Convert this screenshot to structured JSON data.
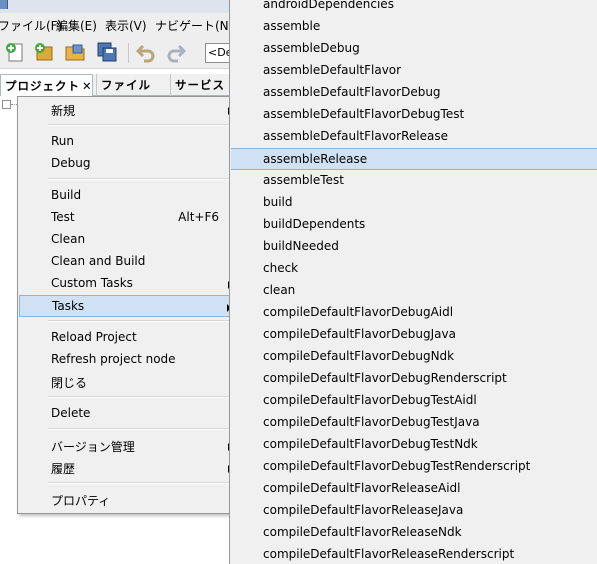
{
  "menubar": {
    "items": [
      "ファイル(F)",
      "編集(E)",
      "表示(V)",
      "ナビゲート(N)"
    ]
  },
  "toolbar": {
    "combo_value": "<De"
  },
  "panel_tabs": [
    {
      "label": "プロジェクト",
      "close": "✕"
    },
    {
      "label": "ファイル"
    },
    {
      "label": "サービス"
    }
  ],
  "tree": {
    "expander": "⊟"
  },
  "context_menu": {
    "new": "新規",
    "run": "Run",
    "debug": "Debug",
    "build": "Build",
    "test": "Test",
    "test_shortcut": "Alt+F6",
    "clean": "Clean",
    "clean_and_build": "Clean and Build",
    "custom_tasks": "Custom Tasks",
    "tasks": "Tasks",
    "reload_project": "Reload Project",
    "refresh_project_node": "Refresh project node",
    "close": "閉じる",
    "delete": "Delete",
    "version_control": "バージョン管理",
    "history": "履歴",
    "properties": "プロパティ"
  },
  "tasks_submenu": {
    "highlighted": "assembleRelease",
    "items": [
      "androidDependencies",
      "assemble",
      "assembleDebug",
      "assembleDefaultFlavor",
      "assembleDefaultFlavorDebug",
      "assembleDefaultFlavorDebugTest",
      "assembleDefaultFlavorRelease",
      "assembleRelease",
      "assembleTest",
      "build",
      "buildDependents",
      "buildNeeded",
      "check",
      "clean",
      "compileDefaultFlavorDebugAidl",
      "compileDefaultFlavorDebugJava",
      "compileDefaultFlavorDebugNdk",
      "compileDefaultFlavorDebugRenderscript",
      "compileDefaultFlavorDebugTestAidl",
      "compileDefaultFlavorDebugTestJava",
      "compileDefaultFlavorDebugTestNdk",
      "compileDefaultFlavorDebugTestRenderscript",
      "compileDefaultFlavorReleaseAidl",
      "compileDefaultFlavorReleaseJava",
      "compileDefaultFlavorReleaseNdk",
      "compileDefaultFlavorReleaseRenderscript"
    ]
  },
  "colors": {
    "highlight": "#cfe1f3",
    "highlight_border": "#8fb4dc",
    "menu_bg": "#f0f0f0"
  }
}
